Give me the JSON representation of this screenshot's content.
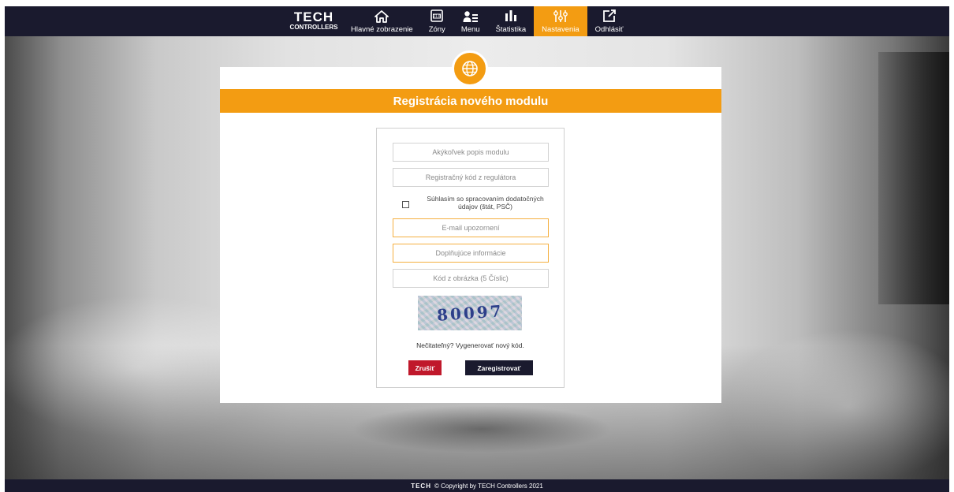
{
  "topbar": {
    "logo": {
      "brand": "TECH",
      "sub": "CONTROLLERS"
    },
    "nav": [
      {
        "label": "Hlavné zobrazenie",
        "icon": "home-icon"
      },
      {
        "label": "Zóny",
        "icon": "zones-icon"
      },
      {
        "label": "Menu",
        "icon": "menu-icon"
      },
      {
        "label": "Štatistika",
        "icon": "statistics-icon"
      },
      {
        "label": "Nastavenia",
        "icon": "settings-icon",
        "active": true
      },
      {
        "label": "Odhlásiť",
        "icon": "logout-icon"
      }
    ]
  },
  "card": {
    "title": "Registrácia nového modulu",
    "icon": "globe-icon"
  },
  "form": {
    "description_placeholder": "Akýkoľvek popis modulu",
    "regcode_placeholder": "Registračný kód z regulátora",
    "consent_label": "Súhlasím so spracovaním dodatočných údajov (štát, PSČ)",
    "email_placeholder": "E-mail upozornení",
    "info_placeholder": "Doplňujúce informácie",
    "captcha_placeholder": "Kód z obrázka (5 Číslic)",
    "captcha_text": "80097",
    "regenerate_text": "Nečitateľný? Vygenerovať nový kód.",
    "cancel_label": "Zrušiť",
    "register_label": "Zaregistrovať"
  },
  "footer": {
    "brand": "TECH",
    "copyright": "© Copyright by TECH Controllers 2021"
  },
  "colors": {
    "accent": "#f39c12",
    "nav_bg": "#1a1a2e",
    "cancel": "#c0182b"
  }
}
